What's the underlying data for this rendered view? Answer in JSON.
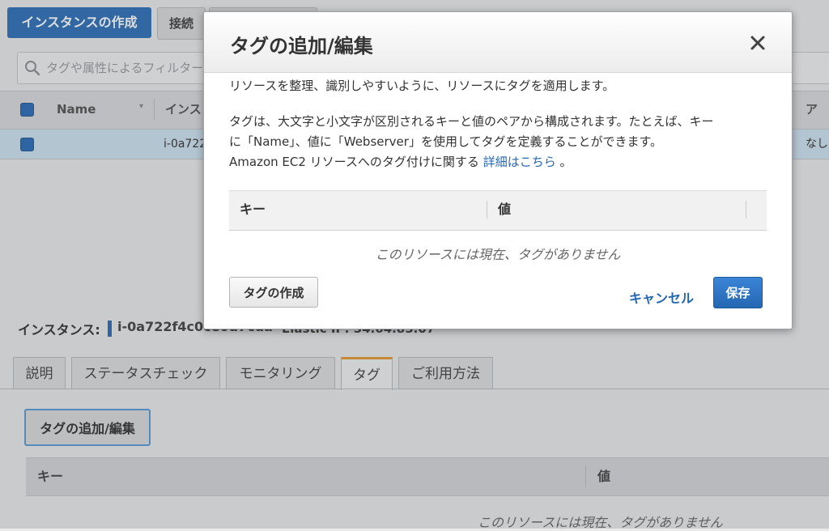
{
  "toolbar": {
    "create_instance": "インスタンスの作成",
    "connect": "接続"
  },
  "filter": {
    "placeholder": "タグや属性によるフィルター"
  },
  "grid": {
    "headers": {
      "name": "Name",
      "instance": "インス",
      "alarm": "アラ"
    },
    "row": {
      "instance_id": "i-0a722",
      "alarm": "なし"
    }
  },
  "details": {
    "instance_label": "インスタンス:",
    "instance_id": "i-0a722f4c0ce0d7cda",
    "elastic_ip": "Elastic IP: 54.64.85.07",
    "tabs": [
      "説明",
      "ステータスチェック",
      "モニタリング",
      "タグ",
      "ご利用方法"
    ],
    "active_tab": "タグ",
    "add_edit_button": "タグの追加/編集",
    "table": {
      "key": "キー",
      "value": "値"
    },
    "empty": "このリソースには現在、タグがありません"
  },
  "modal": {
    "title": "タグの追加/編集",
    "close": "×",
    "description1": "リソースを整理、識別しやすいように、リソースにタグを適用します。",
    "description2_line1": "タグは、大文字と小文字が区別されるキーと値のペアから構成されます。たとえば、キー",
    "description2_line2": "に「Name」、値に「Webserver」を使用してタグを定義することができます。",
    "description2_line3": "Amazon EC2 リソースへのタグ付けに関する",
    "link": "詳細はこちら",
    "period": "。",
    "table": {
      "key": "キー",
      "value": "値"
    },
    "empty": "このリソースには現在、タグがありません",
    "create_button": "タグの作成",
    "cancel_button": "キャンセル",
    "save_button": "保存"
  }
}
